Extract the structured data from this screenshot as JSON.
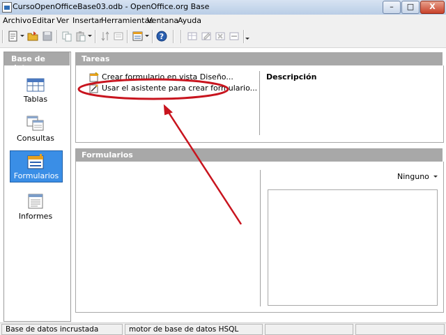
{
  "window": {
    "title": "CursoOpenOfficeBase03.odb - OpenOffice.org Base",
    "minimize": "–",
    "maximize": "□",
    "close": "X"
  },
  "menu": {
    "items": [
      "Archivo",
      "Editar",
      "Ver",
      "Insertar",
      "Herramientas",
      "Ventana",
      "Ayuda"
    ]
  },
  "toolbar": {
    "icons": [
      "new-document-icon",
      "open-folder-icon",
      "save-icon",
      "copy-icon",
      "paste-icon",
      "sort-icon",
      "form-icon",
      "help-icon",
      "table-icon",
      "edit-icon",
      "delete-icon",
      "rename-icon"
    ]
  },
  "sidebar": {
    "header": "Base de datos",
    "items": [
      {
        "label": "Tablas",
        "selected": false
      },
      {
        "label": "Consultas",
        "selected": false
      },
      {
        "label": "Formularios",
        "selected": true
      },
      {
        "label": "Informes",
        "selected": false
      }
    ]
  },
  "tasks": {
    "header": "Tareas",
    "items": [
      "Crear formulario en vista Diseño...",
      "Usar el asistente para crear formulario..."
    ],
    "description_label": "Descripción"
  },
  "forms": {
    "header": "Formularios",
    "preview_select": "Ninguno"
  },
  "statusbar": {
    "fields": [
      "Base de datos incrustada",
      "motor de base de datos HSQL",
      "",
      ""
    ]
  },
  "colors": {
    "selection": "#3a8ee6",
    "panel_header": "#a8a8a8",
    "annotation": "#c8141e"
  }
}
